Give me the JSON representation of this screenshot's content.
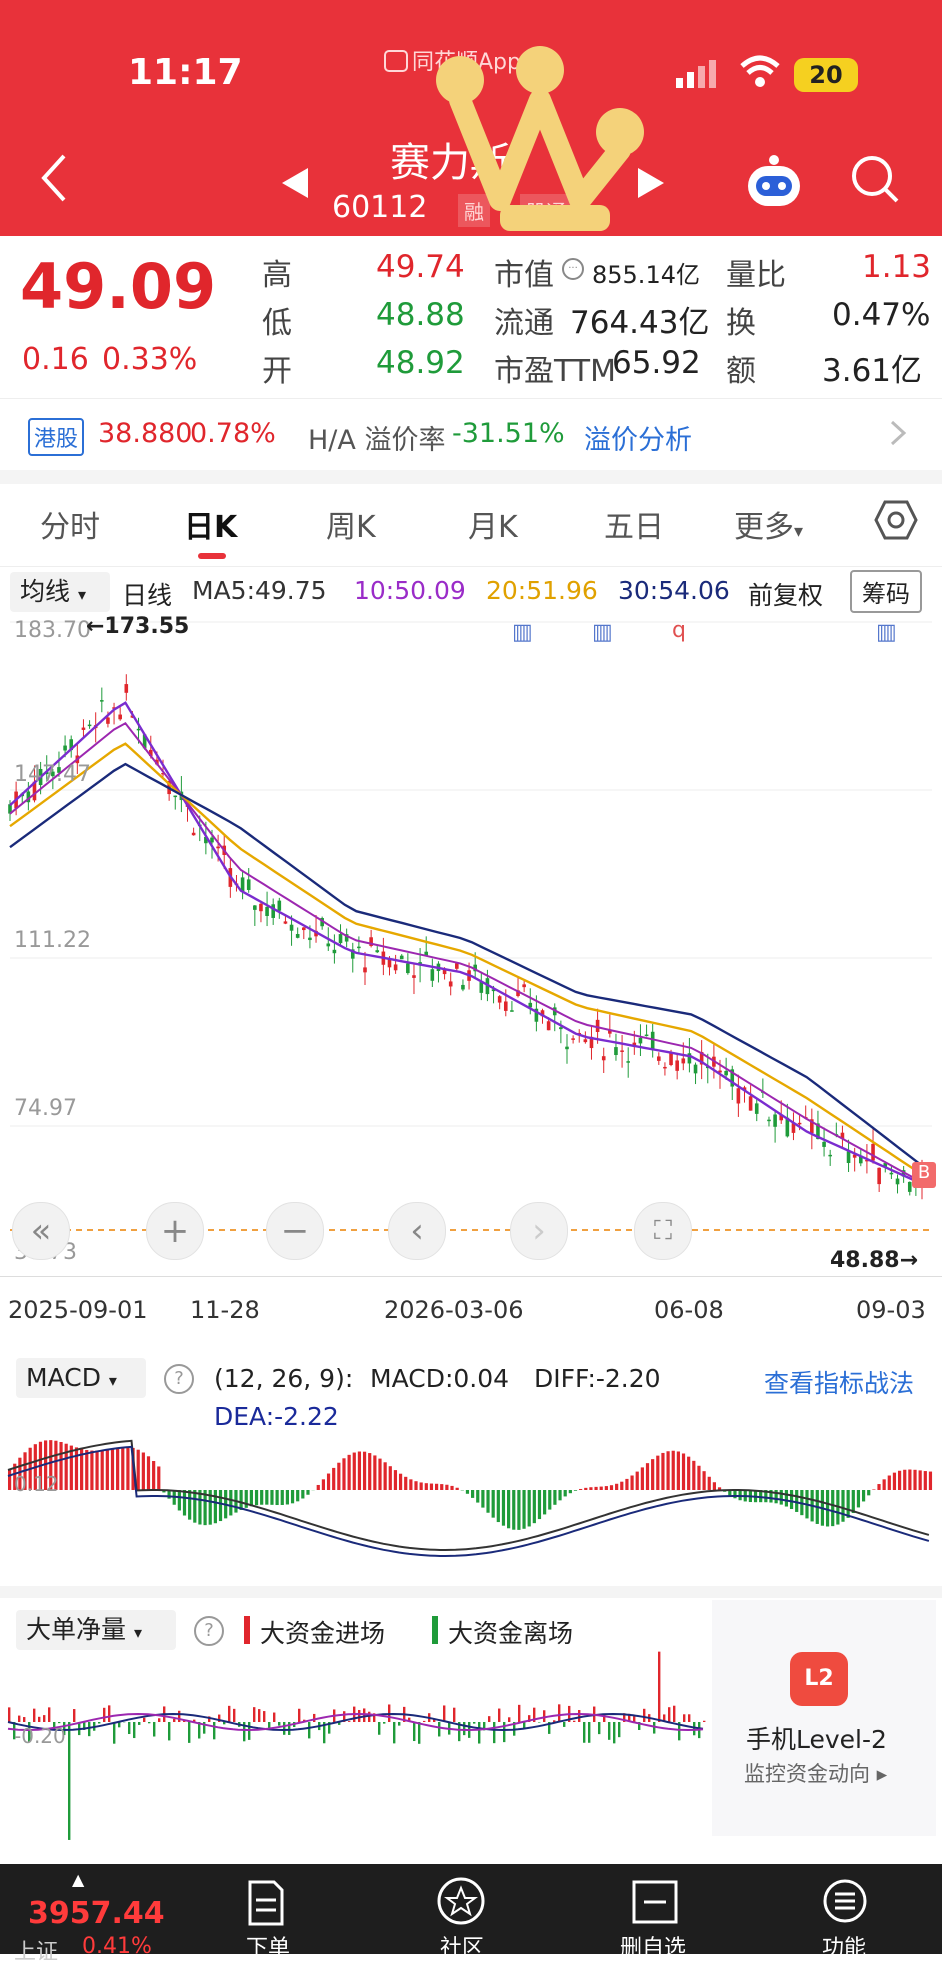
{
  "status_bar": {
    "time": "11:17",
    "battery": "20"
  },
  "header": {
    "source_app": "同花顺App",
    "stock_name": "赛力斯",
    "stock_code": "60112",
    "tag_rong": "融",
    "tag_gutong": "股通"
  },
  "quote": {
    "price": "49.09",
    "change": "0.16",
    "change_pct": "0.33%",
    "high_label": "高",
    "high": "49.74",
    "low_label": "低",
    "low": "48.88",
    "open_label": "开",
    "open": "48.92",
    "mcap_label": "市值",
    "mcap": "855.14亿",
    "float_label": "流通",
    "float": "764.43亿",
    "pe_label": "市盈TTM",
    "pe": "65.92",
    "vol_ratio_label": "量比",
    "vol_ratio": "1.13",
    "turnover_label": "换",
    "turnover": "0.47%",
    "amount_label": "额",
    "amount": "3.61亿"
  },
  "hk_row": {
    "badge": "港股",
    "price": "38.880",
    "pct": "0.78%",
    "premium_label": "H/A 溢价率",
    "premium": "-31.51%",
    "link": "溢价分析"
  },
  "tabs": [
    "分时",
    "日K",
    "周K",
    "月K",
    "五日",
    "更多"
  ],
  "ma_row": {
    "selector": "均线",
    "period": "日线",
    "ma5": "MA5:49.75",
    "ma10": "10:50.09",
    "ma20": "20:51.96",
    "ma30": "30:54.06",
    "adjust": "前复权",
    "chips": "筹码"
  },
  "chart_labels": {
    "y_top": "183.70",
    "peak": "←173.55",
    "y2": "147.47",
    "y3": "111.22",
    "y4": "74.97",
    "y5": "38.73",
    "low": "48.88→",
    "marker_b": "B"
  },
  "x_axis": [
    "2025-09-01",
    "11-28",
    "2026-03-06",
    "06-08",
    "09-03"
  ],
  "macd": {
    "selector": "MACD",
    "params": "(12, 26, 9):",
    "macd": "MACD:0.04",
    "diff": "DIFF:-2.20",
    "dea": "DEA:-2.22",
    "link": "查看指标战法",
    "axis": "0.12"
  },
  "flow": {
    "selector": "大单净量",
    "in": "大资金进场",
    "out": "大资金离场",
    "axis": "-0.20",
    "promo_title": "手机Level-2",
    "promo_sub": "监控资金动向",
    "promo_badge": "L2"
  },
  "bottom_nav": {
    "index_value": "3957.44",
    "index_name": "上证",
    "index_pct": "0.41%",
    "items": [
      "下单",
      "社区",
      "删自选",
      "功能"
    ]
  },
  "chart_data": {
    "type": "line",
    "title": "",
    "x": [
      "2025-09-01",
      "11-28",
      "2026-03-06",
      "06-08",
      "09-03"
    ],
    "ylim": [
      38.73,
      183.7
    ],
    "series": [
      {
        "name": "MA5",
        "values": [
          140,
          165,
          120,
          105,
          100,
          85,
          80,
          62,
          49.75
        ]
      },
      {
        "name": "10",
        "values": [
          138,
          160,
          125,
          108,
          102,
          88,
          82,
          65,
          50.09
        ]
      },
      {
        "name": "20",
        "values": [
          135,
          155,
          130,
          112,
          105,
          92,
          86,
          70,
          51.96
        ]
      },
      {
        "name": "30",
        "values": [
          130,
          150,
          135,
          115,
          108,
          95,
          90,
          75,
          54.06
        ]
      }
    ]
  },
  "colors": {
    "brand_red": "#e8323a",
    "up": "#e0262c",
    "down": "#1f9b3a"
  }
}
